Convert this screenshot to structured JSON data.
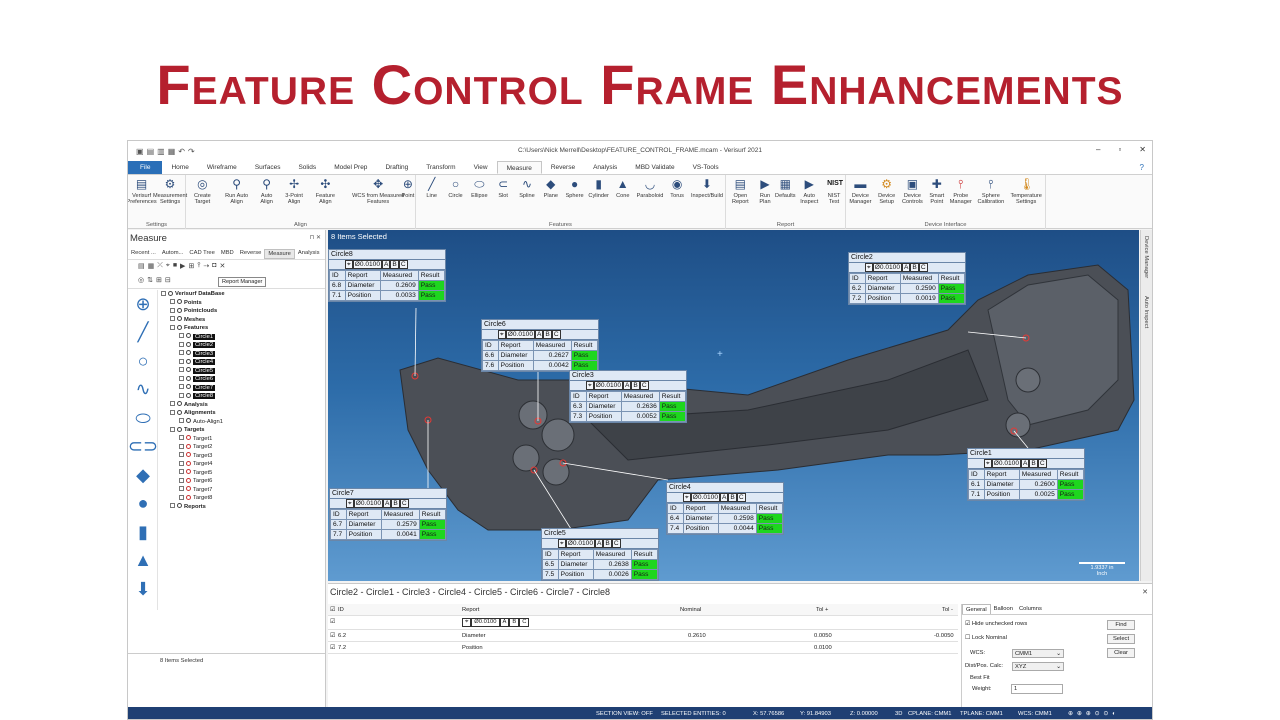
{
  "slide_title": "Feature Control Frame Enhancements",
  "window": {
    "title": "C:\\Users\\Nick Merrell\\Desktop\\FEATURE_CONTROL_FRAME.mcam - Verisurf 2021"
  },
  "tabs": [
    "File",
    "Home",
    "Wireframe",
    "Surfaces",
    "Solids",
    "Model Prep",
    "Drafting",
    "Transform",
    "View",
    "Measure",
    "Reverse",
    "Analysis",
    "MBD Validate",
    "VS-Tools"
  ],
  "active_tab": "Measure",
  "ribbon": {
    "groups": [
      {
        "label": "Settings",
        "buttons": [
          "Verisurf Preferences",
          "Measurement Settings"
        ]
      },
      {
        "label": "Align",
        "buttons": [
          "Create Target",
          "Run Auto Align",
          "Auto Align",
          "3-Point Align",
          "Feature Align",
          "WCS from Measured Features"
        ]
      },
      {
        "label": "Features",
        "buttons": [
          "Point",
          "Line",
          "Circle",
          "Ellipse",
          "Slot",
          "Spline",
          "Plane",
          "Sphere",
          "Cylinder",
          "Cone",
          "Paraboloid",
          "Torus",
          "Inspect/Build"
        ]
      },
      {
        "label": "Report",
        "buttons": [
          "Open Report",
          "Run Plan",
          "Defaults",
          "Auto Inspect",
          "NIST Test"
        ]
      },
      {
        "label": "Device Interface",
        "buttons": [
          "Device Manager",
          "Device Setup",
          "Device Controls",
          "Smart Point",
          "Probe Manager",
          "Sphere Calibration",
          "Temperature Settings"
        ]
      }
    ]
  },
  "left_panel": {
    "title": "Measure",
    "tabs": [
      "Recent ...",
      "Autom...",
      "CAD Tree",
      "MBD",
      "Reverse",
      "Measure",
      "Analysis"
    ],
    "active_tab": "Measure",
    "tooltip": "Report Manager",
    "tree": [
      {
        "label": "Verisurf DataBase",
        "indent": 0,
        "bold": true
      },
      {
        "label": "Points",
        "indent": 1,
        "bold": true
      },
      {
        "label": "Pointclouds",
        "indent": 1,
        "bold": true
      },
      {
        "label": "Meshes",
        "indent": 1,
        "bold": true
      },
      {
        "label": "Features",
        "indent": 1,
        "bold": true
      },
      {
        "label": "Circle1",
        "indent": 2,
        "selected": true
      },
      {
        "label": "Circle2",
        "indent": 2,
        "selected": true
      },
      {
        "label": "Circle3",
        "indent": 2,
        "selected": true
      },
      {
        "label": "Circle4",
        "indent": 2,
        "selected": true
      },
      {
        "label": "Circle5",
        "indent": 2,
        "selected": true
      },
      {
        "label": "Circle6",
        "indent": 2,
        "selected": true
      },
      {
        "label": "Circle7",
        "indent": 2,
        "selected": true
      },
      {
        "label": "Circle8",
        "indent": 2,
        "selected": true
      },
      {
        "label": "Analysis",
        "indent": 1,
        "bold": true
      },
      {
        "label": "Alignments",
        "indent": 1,
        "bold": true
      },
      {
        "label": "Auto-Align1",
        "indent": 2
      },
      {
        "label": "Targets",
        "indent": 1,
        "bold": true
      },
      {
        "label": "Target1",
        "indent": 2,
        "target": true
      },
      {
        "label": "Target2",
        "indent": 2,
        "target": true
      },
      {
        "label": "Target3",
        "indent": 2,
        "target": true
      },
      {
        "label": "Target4",
        "indent": 2,
        "target": true
      },
      {
        "label": "Target5",
        "indent": 2,
        "target": true
      },
      {
        "label": "Target6",
        "indent": 2,
        "target": true
      },
      {
        "label": "Target7",
        "indent": 2,
        "target": true
      },
      {
        "label": "Target8",
        "indent": 2,
        "target": true
      },
      {
        "label": "Reports",
        "indent": 1,
        "bold": true
      }
    ],
    "status": "8 Items Selected"
  },
  "viewport": {
    "label": "8 Items Selected",
    "scale_text": "1.9337 in",
    "scale_unit": "Inch",
    "side_tabs": [
      "Device Manager",
      "Auto Inspect"
    ],
    "frames": [
      {
        "name": "Circle8",
        "tol": "Ø0.0100",
        "d": [
          "A",
          "B",
          "C"
        ],
        "rows": [
          [
            "6.8",
            "Diameter",
            "0.2609",
            "Pass"
          ],
          [
            "7.1",
            "Position",
            "0.0033",
            "Pass"
          ]
        ]
      },
      {
        "name": "Circle2",
        "tol": "Ø0.0100",
        "d": [
          "A",
          "B",
          "C"
        ],
        "rows": [
          [
            "6.2",
            "Diameter",
            "0.2590",
            "Pass"
          ],
          [
            "7.2",
            "Position",
            "0.0019",
            "Pass"
          ]
        ]
      },
      {
        "name": "Circle6",
        "tol": "Ø0.0100",
        "d": [
          "A",
          "B",
          "C"
        ],
        "rows": [
          [
            "6.6",
            "Diameter",
            "0.2627",
            "Pass"
          ],
          [
            "7.6",
            "Position",
            "0.0042",
            "Pass"
          ]
        ]
      },
      {
        "name": "Circle3",
        "tol": "Ø0.0100",
        "d": [
          "A",
          "B",
          "C"
        ],
        "rows": [
          [
            "6.3",
            "Diameter",
            "0.2636",
            "Pass"
          ],
          [
            "7.3",
            "Position",
            "0.0052",
            "Pass"
          ]
        ]
      },
      {
        "name": "Circle1",
        "tol": "Ø0.0100",
        "d": [
          "A",
          "B",
          "C"
        ],
        "rows": [
          [
            "6.1",
            "Diameter",
            "0.2600",
            "Pass"
          ],
          [
            "7.1",
            "Position",
            "0.0025",
            "Pass"
          ]
        ]
      },
      {
        "name": "Circle4",
        "tol": "Ø0.0100",
        "d": [
          "A",
          "B",
          "C"
        ],
        "rows": [
          [
            "6.4",
            "Diameter",
            "0.2598",
            "Pass"
          ],
          [
            "7.4",
            "Position",
            "0.0044",
            "Pass"
          ]
        ]
      },
      {
        "name": "Circle7",
        "tol": "Ø0.0100",
        "d": [
          "A",
          "B",
          "C"
        ],
        "rows": [
          [
            "6.7",
            "Diameter",
            "0.2579",
            "Pass"
          ],
          [
            "7.7",
            "Position",
            "0.0041",
            "Pass"
          ]
        ]
      },
      {
        "name": "Circle5",
        "tol": "Ø0.0100",
        "d": [
          "A",
          "B",
          "C"
        ],
        "rows": [
          [
            "6.5",
            "Diameter",
            "0.2638",
            "Pass"
          ],
          [
            "7.5",
            "Position",
            "0.0026",
            "Pass"
          ]
        ]
      }
    ],
    "table_headers": [
      "ID",
      "Report",
      "Measured",
      "Result"
    ]
  },
  "bottom_panel": {
    "title": "Circle2 - Circle1 - Circle3 - Circle4 - Circle5 - Circle6 - Circle7 - Circle8",
    "columns": [
      "ID",
      "Report",
      "Nominal",
      "Tol +",
      "Tol -"
    ],
    "fcf": "Ø0.0100",
    "fcf_datums": [
      "A",
      "B",
      "C"
    ],
    "rows": [
      {
        "id": "6.2",
        "report": "Diameter",
        "nominal": "0.2610",
        "tol_plus": "0.0050",
        "tol_minus": "-0.0050"
      },
      {
        "id": "7.2",
        "report": "Position",
        "nominal": "",
        "tol_plus": "0.0100",
        "tol_minus": ""
      }
    ],
    "settings": {
      "tabs": [
        "General",
        "Balloon",
        "Columns"
      ],
      "active_tab": "General",
      "hide_unchecked": "Hide unchecked rows",
      "lock_nominal": "Lock Nominal",
      "wcs_label": "WCS:",
      "wcs_value": "CMM1",
      "dist_label": "Dist/Pos. Calc:",
      "dist_value": "XYZ",
      "bestfit_label": "Best Fit",
      "weight_label": "Weight:",
      "weight_value": "1",
      "buttons": [
        "Find",
        "Select",
        "Clear"
      ]
    }
  },
  "status_bar": {
    "section_view": "SECTION VIEW: OFF",
    "selected_entities": "SELECTED ENTITIES: 0",
    "x": "X: 57.76586",
    "y": "Y: 91.84903",
    "z": "Z: 0.00000",
    "mode": "3D",
    "cplane": "CPLANE: CMM1",
    "tplane": "TPLANE: CMM1",
    "wcs": "WCS: CMM1"
  }
}
